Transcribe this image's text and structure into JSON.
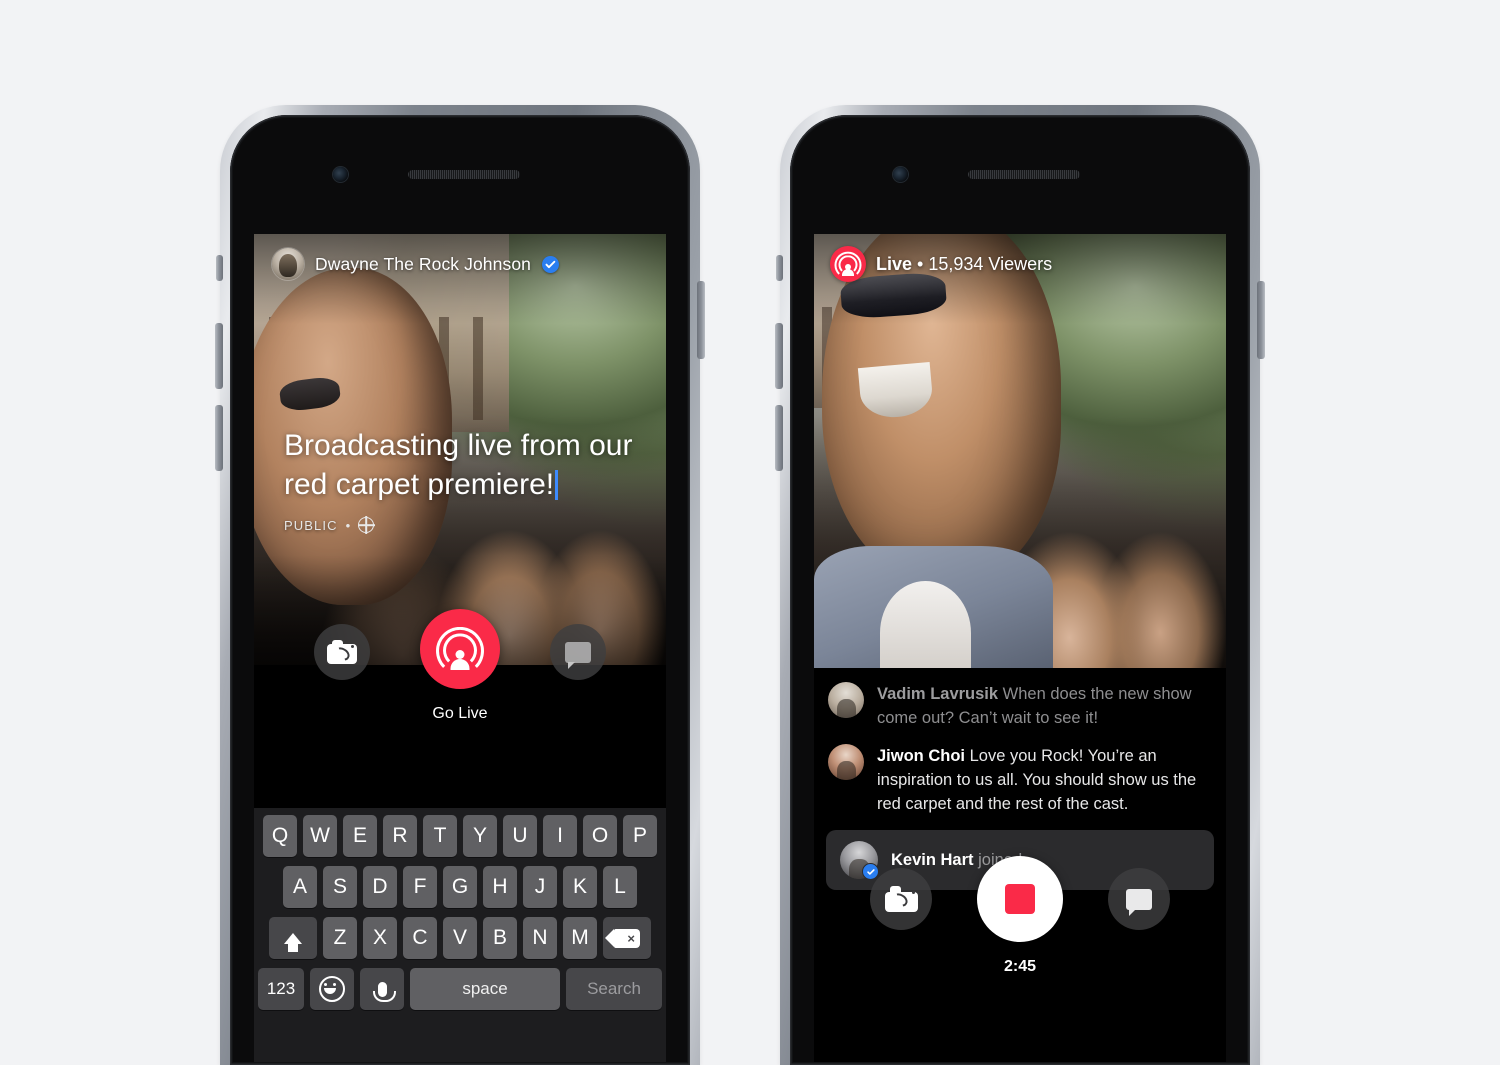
{
  "background_color": "#f2f3f5",
  "accent_colors": {
    "live_red": "#fa2a48",
    "verified_blue": "#2a7ef0",
    "caret_blue": "#3d8bfd",
    "keyboard_bg": "#1d1d1f",
    "key_gray": "#606063",
    "key_dark": "#47474a"
  },
  "phone_left": {
    "name": "facebook-live-composer",
    "header": {
      "avatar": "profile-avatar",
      "author_name": "Dwayne The Rock Johnson",
      "verified_icon": "verified-badge-icon"
    },
    "composer": {
      "line1": "Broadcasting live from our",
      "line2": "red carpet premiere!",
      "caret": "text-cursor",
      "privacy_label": "PUBLIC",
      "privacy_separator": "•",
      "privacy_icon": "globe-icon"
    },
    "controls": {
      "flip_camera_icon": "camera-flip-icon",
      "go_live_icon": "live-broadcast-icon",
      "go_live_label": "Go Live",
      "comments_icon": "chat-bubble-icon"
    },
    "keyboard": {
      "row1": [
        "Q",
        "W",
        "E",
        "R",
        "T",
        "Y",
        "U",
        "I",
        "O",
        "P"
      ],
      "row2": [
        "A",
        "S",
        "D",
        "F",
        "G",
        "H",
        "J",
        "K",
        "L"
      ],
      "row3": [
        "Z",
        "X",
        "C",
        "V",
        "B",
        "N",
        "M"
      ],
      "shift_icon": "shift-arrow-icon",
      "backspace_icon": "backspace-icon",
      "numbers_key": "123",
      "emoji_icon": "emoji-smiley-icon",
      "dictation_icon": "microphone-icon",
      "space_key": "space",
      "return_key": "Search"
    }
  },
  "phone_right": {
    "name": "facebook-live-broadcast",
    "status": {
      "live_icon": "live-broadcast-icon",
      "live_label": "Live",
      "separator": "•",
      "viewers": "15,934 Viewers"
    },
    "comments": [
      {
        "avatar": "commenter-avatar",
        "author": "Vadim Lavrusik",
        "text": "When does the new show come out? Can’t wait to see it!",
        "style": "faded"
      },
      {
        "avatar": "commenter-avatar",
        "author": "Jiwon Choi",
        "text": "Love you Rock! You’re an inspiration to us all. You should show us the red carpet and the rest of the cast.",
        "style": "bright"
      }
    ],
    "join_notice": {
      "avatar": "joined-user-avatar",
      "verified_icon": "verified-badge-icon",
      "author": "Kevin Hart",
      "text": "joined."
    },
    "controls": {
      "flip_camera_icon": "camera-flip-icon",
      "stop_icon": "stop-recording-icon",
      "elapsed_time": "2:45",
      "comments_icon": "chat-bubble-icon"
    }
  }
}
